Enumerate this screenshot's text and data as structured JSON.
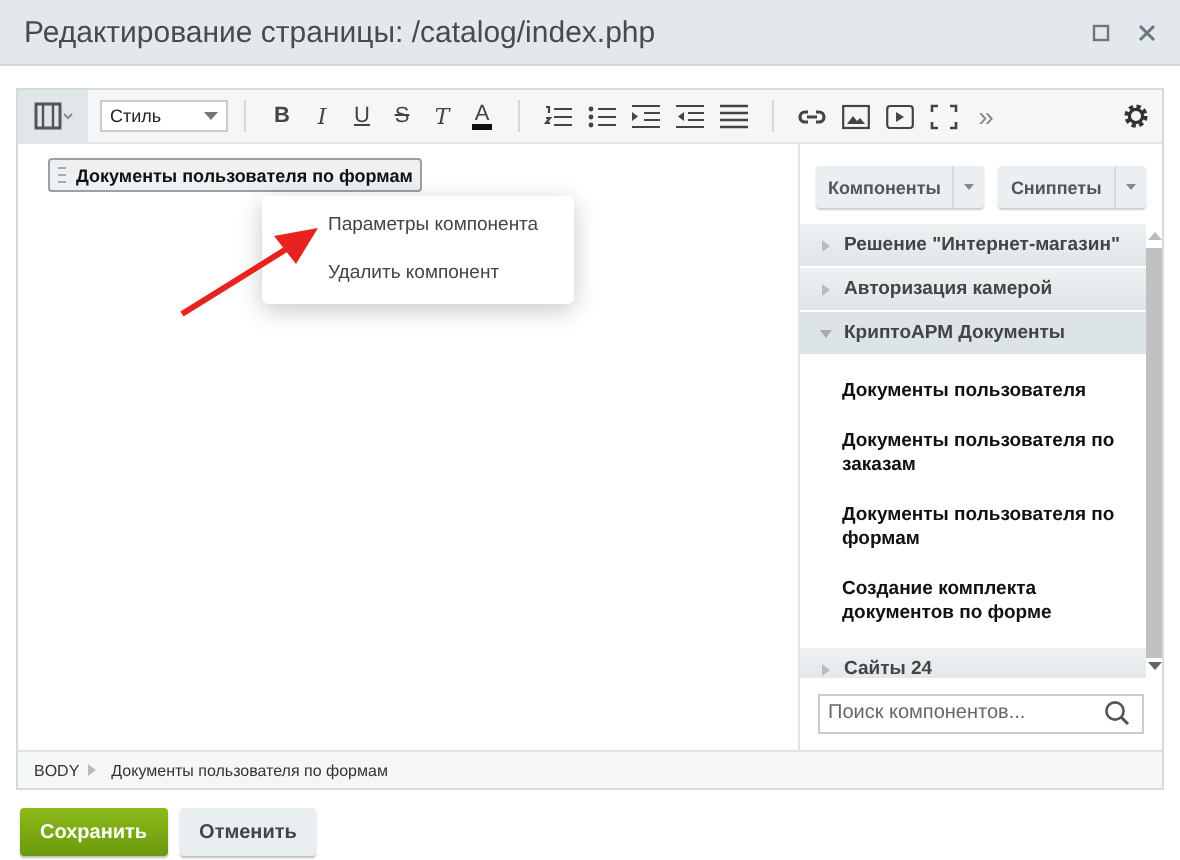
{
  "window": {
    "title": "Редактирование страницы: /catalog/index.php"
  },
  "toolbar": {
    "style_select": "Стиль",
    "items": [
      {
        "kind": "bold",
        "label": "B"
      },
      {
        "kind": "italic",
        "label": "I"
      },
      {
        "kind": "underline",
        "label": "U"
      },
      {
        "kind": "strike",
        "label": "S"
      },
      {
        "kind": "clear",
        "label": "T"
      },
      {
        "kind": "color",
        "label": "A"
      },
      {
        "kind": "sep"
      },
      {
        "kind": "ol"
      },
      {
        "kind": "ul"
      },
      {
        "kind": "indent"
      },
      {
        "kind": "outdent"
      },
      {
        "kind": "justify"
      },
      {
        "kind": "sep"
      },
      {
        "kind": "link"
      },
      {
        "kind": "image"
      },
      {
        "kind": "video"
      },
      {
        "kind": "fullscreen"
      },
      {
        "kind": "more",
        "label": "»"
      }
    ]
  },
  "editor": {
    "component": "Документы пользователя по формам",
    "context_menu": [
      "Параметры компонента",
      "Удалить компонент"
    ]
  },
  "panel": {
    "buttons": [
      "Компоненты",
      "Сниппеты"
    ],
    "groups": [
      {
        "label": "Решение \"Интернет-магазин\"",
        "expanded": false
      },
      {
        "label": "Авторизация камерой",
        "expanded": false
      },
      {
        "label": "КриптоАРМ Документы",
        "expanded": true,
        "children": [
          "Документы пользователя",
          "Документы пользователя по заказам",
          "Документы пользователя по формам",
          "Создание комплекта документов по форме"
        ]
      },
      {
        "label": "Сайты 24",
        "expanded": false
      }
    ],
    "search": {
      "placeholder": "Поиск компонентов..."
    }
  },
  "status_bar": [
    "BODY",
    "Документы пользователя по формам"
  ],
  "footer": [
    {
      "label": "Сохранить",
      "kind": "primary"
    },
    {
      "label": "Отменить",
      "kind": "secondary"
    }
  ]
}
